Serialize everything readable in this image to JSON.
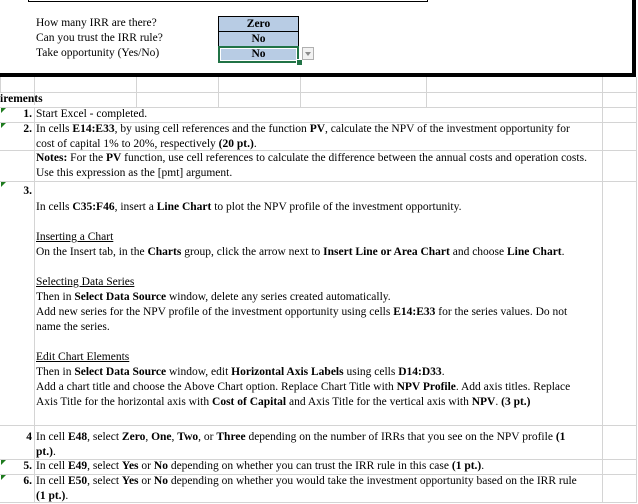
{
  "summary": {
    "questions": [
      {
        "label": "How many IRR are there?",
        "answer": "Zero"
      },
      {
        "label": "Can you trust the IRR rule?",
        "answer": "No"
      },
      {
        "label": "Take opportunity (Yes/No)",
        "answer": "No"
      }
    ],
    "selected_index": 2,
    "dropdown_icon": "dropdown-arrow-icon"
  },
  "requirements": {
    "title": "irements",
    "items": [
      {
        "num": "1.",
        "text": "Start Excel - completed."
      },
      {
        "num": "2.",
        "line1_a": "In cells ",
        "line1_b": "E14:E33",
        "line1_c": ", by using cell references and the function ",
        "line1_d": "PV",
        "line1_e": ", calculate the NPV of the investment opportunity for",
        "line2_a": "cost of capital 1% to 20%, respectively ",
        "line2_b": "(20 pt.)",
        "line2_c": ".",
        "notes_label": "Notes:",
        "notes_a": " For the ",
        "notes_b": "PV",
        "notes_c": " function, use cell references to calculate the difference between the annual costs and operation costs.",
        "notes_line2": "Use this expression as the [pmt] argument."
      },
      {
        "num": "3.",
        "intro_a": "In cells ",
        "intro_b": "C35:F46",
        "intro_c": ", insert a ",
        "intro_d": "Line Chart",
        "intro_e": " to plot the NPV profile of the investment opportunity.",
        "h1": "Inserting a Chart",
        "p1_a": "On the Insert tab, in the ",
        "p1_b": "Charts",
        "p1_c": " group, click the arrow next to ",
        "p1_d": "Insert Line or Area Chart",
        "p1_e": " and choose ",
        "p1_f": "Line Chart",
        "p1_g": ".",
        "h2": "Selecting Data Series",
        "p2_a": "Then in ",
        "p2_b": "Select Data Source",
        "p2_c": " window, delete any series created automatically.",
        "p3_a": "Add new series for the NPV profile of the investment opportunity using cells ",
        "p3_b": "E14:E33",
        "p3_c": " for the series values. Do not",
        "p3_line2": "name the series.",
        "h3": "Edit Chart Elements",
        "p4_a": "Then in ",
        "p4_b": "Select Data Source",
        "p4_c": " window, edit ",
        "p4_d": "Horizontal Axis Labels",
        "p4_e": " using cells ",
        "p4_f": "D14:D33",
        "p4_g": ".",
        "p5_a": "Add a chart title and choose the Above Chart option. Replace Chart Title with ",
        "p5_b": "NPV Profile",
        "p5_c": ". Add axis titles. Replace",
        "p6_a": "Axis Title for the horizontal axis with ",
        "p6_b": "Cost of Capital",
        "p6_c": " and Axis Title for the vertical axis with ",
        "p6_d": "NPV",
        "p6_e": ". ",
        "p6_f": "(3 pt.)"
      },
      {
        "num": "4",
        "a": "In cell ",
        "b": "E48",
        "c": ", select ",
        "d": "Zero",
        "e": ", ",
        "f": "One",
        "g": ", ",
        "h": "Two",
        "i": ", or ",
        "j": "Three",
        "k": " depending on the number of IRRs that you see on the NPV profile ",
        "l": "(1",
        "line2_a": "pt.)",
        "line2_b": "."
      },
      {
        "num": "5.",
        "a": "In cell ",
        "b": "E49",
        "c": ", select ",
        "d": "Yes",
        "e": " or ",
        "f": "No",
        "g": " depending on whether you can trust the IRR rule in this case ",
        "h": "(1 pt.)",
        "i": "."
      },
      {
        "num": "6.",
        "a": "In cell ",
        "b": "E50",
        "c": ", select ",
        "d": "Yes",
        "e": " or ",
        "f": "No",
        "g": " depending on whether you would take the investment opportunity based on the IRR rule",
        "line2_a": "(1 pt.)",
        "line2_b": "."
      }
    ]
  },
  "colors": {
    "answer_fill": "#b8cce4",
    "selection_border": "#217346",
    "comment_flag": "#1e7b1e",
    "gridline": "#d4d4d4"
  }
}
